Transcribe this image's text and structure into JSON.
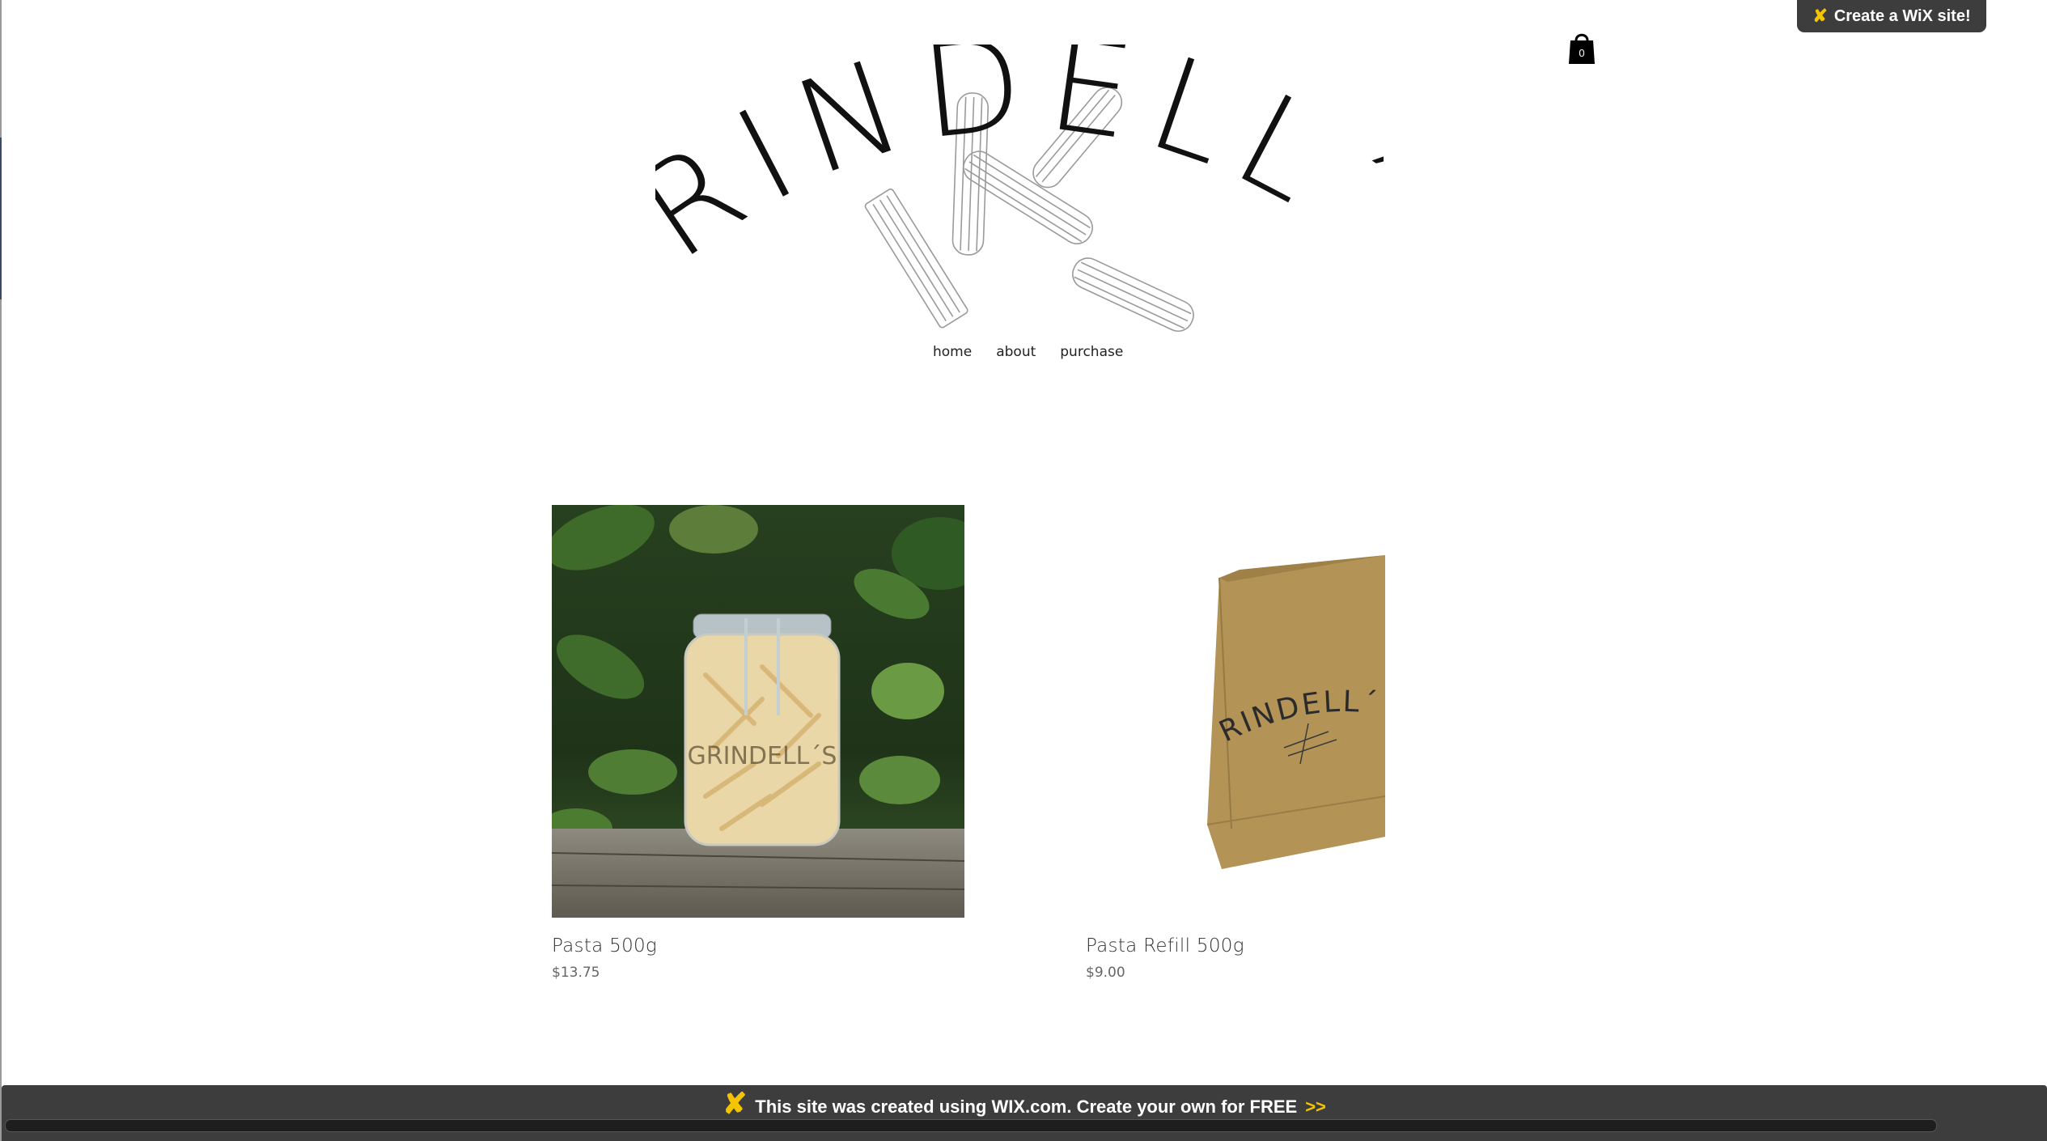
{
  "wix_badge": {
    "label": "Create a WiX site!",
    "icon": "wix-x-icon"
  },
  "cart": {
    "count": "0",
    "icon": "shopping-bag-icon"
  },
  "logo": {
    "text": "GRINDELL´S"
  },
  "nav": {
    "items": [
      "home",
      "about",
      "purchase"
    ]
  },
  "products": [
    {
      "name": "Pasta 500g",
      "price": "$13.75",
      "image": "pasta-jar-photo"
    },
    {
      "name": "Pasta Refill 500g",
      "price": "$9.00",
      "image": "paper-bag-photo",
      "bag_logo": "GRINDELL´S"
    }
  ],
  "footer_bar": {
    "text": "This site was created using WIX.com. Create your own for FREE",
    "arrows": ">>"
  },
  "colors": {
    "bar_bg": "#3d3d3d",
    "wix_yellow": "#f5c400",
    "bag_kraft": "#b39356"
  }
}
